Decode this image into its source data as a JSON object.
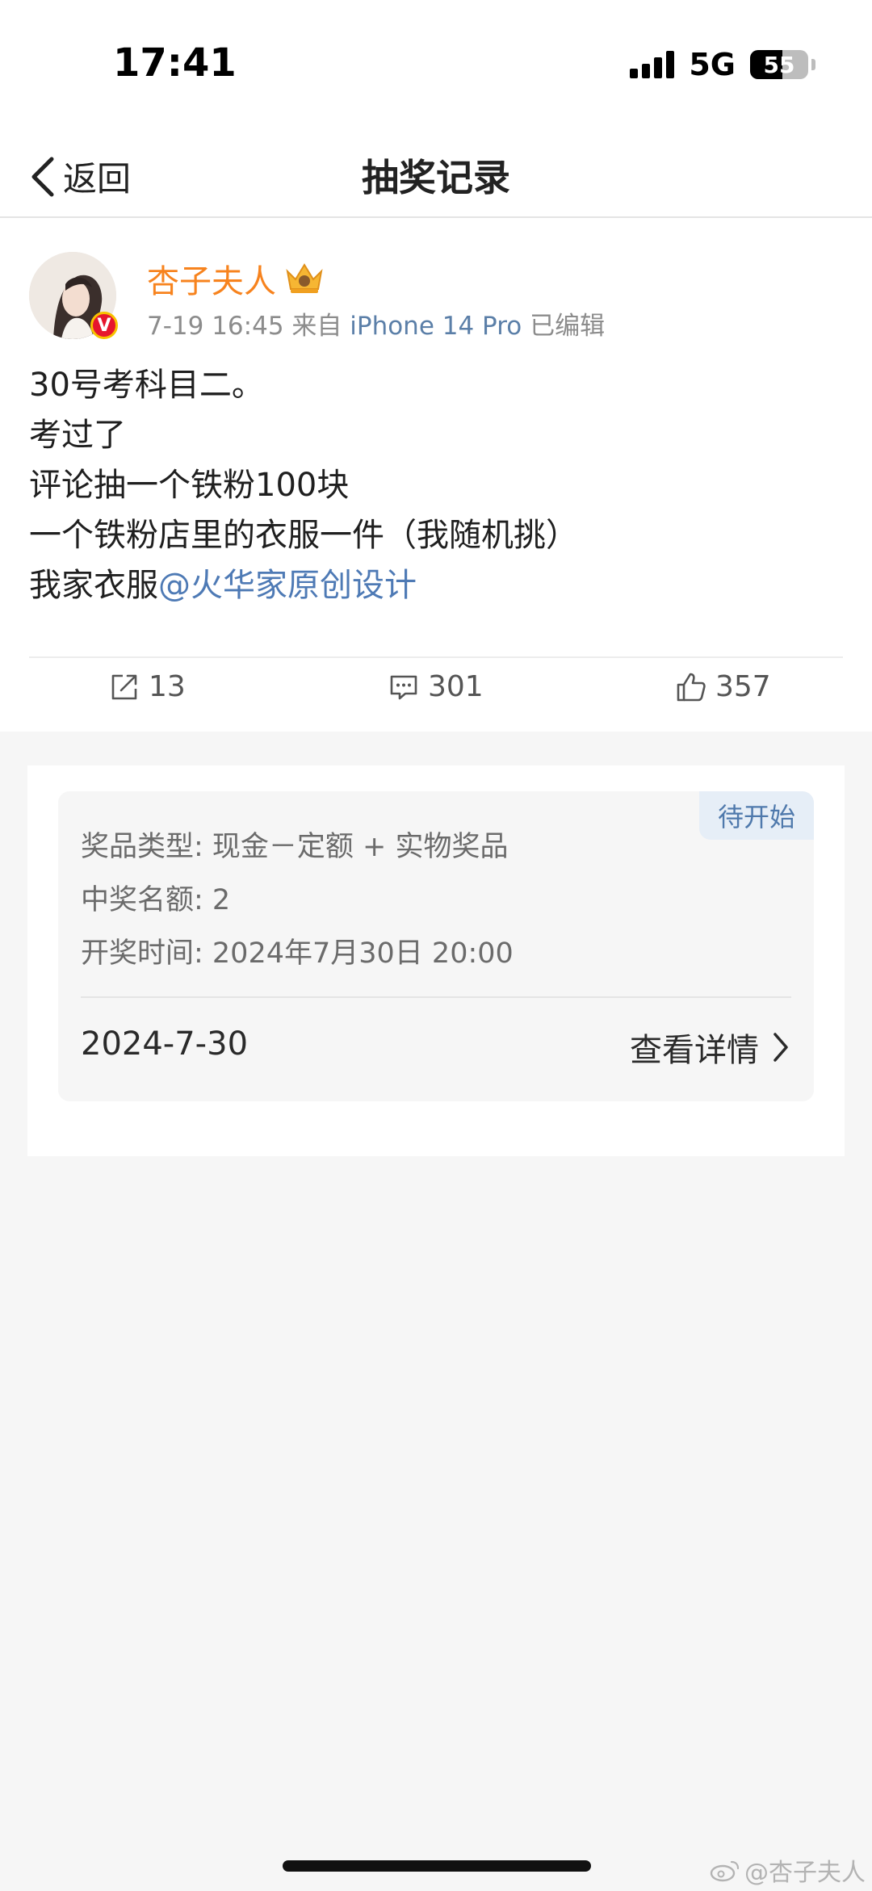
{
  "status_bar": {
    "time": "17:41",
    "network": "5G",
    "battery": "55",
    "battery_level_percent": 55
  },
  "nav": {
    "back_label": "返回",
    "title": "抽奖记录"
  },
  "post": {
    "author": "杏子夫人",
    "verified_badge": "V",
    "time": "7-19 16:45",
    "source_prefix": "来自",
    "source": "iPhone 14 Pro",
    "edited": "已编辑",
    "lines": [
      "30号考科目二。",
      "考过了",
      "评论抽一个铁粉100块",
      "一个铁粉店里的衣服一件（我随机挑）"
    ],
    "last_line_prefix": "我家衣服",
    "mention": "@火华家原创设计",
    "reposts": "13",
    "comments": "301",
    "likes": "357"
  },
  "lottery": {
    "status": "待开始",
    "prize_type": "奖品类型: 现金－定额 + 实物奖品",
    "winners": "中奖名额: 2",
    "draw_time": "开奖时间: 2024年7月30日 20:00",
    "date": "2024-7-30",
    "detail_label": "查看详情"
  },
  "watermark": "@杏子夫人",
  "colors": {
    "author": "#f7831e",
    "link": "#4e7ab5",
    "badge_bg": "#e6eef7"
  }
}
